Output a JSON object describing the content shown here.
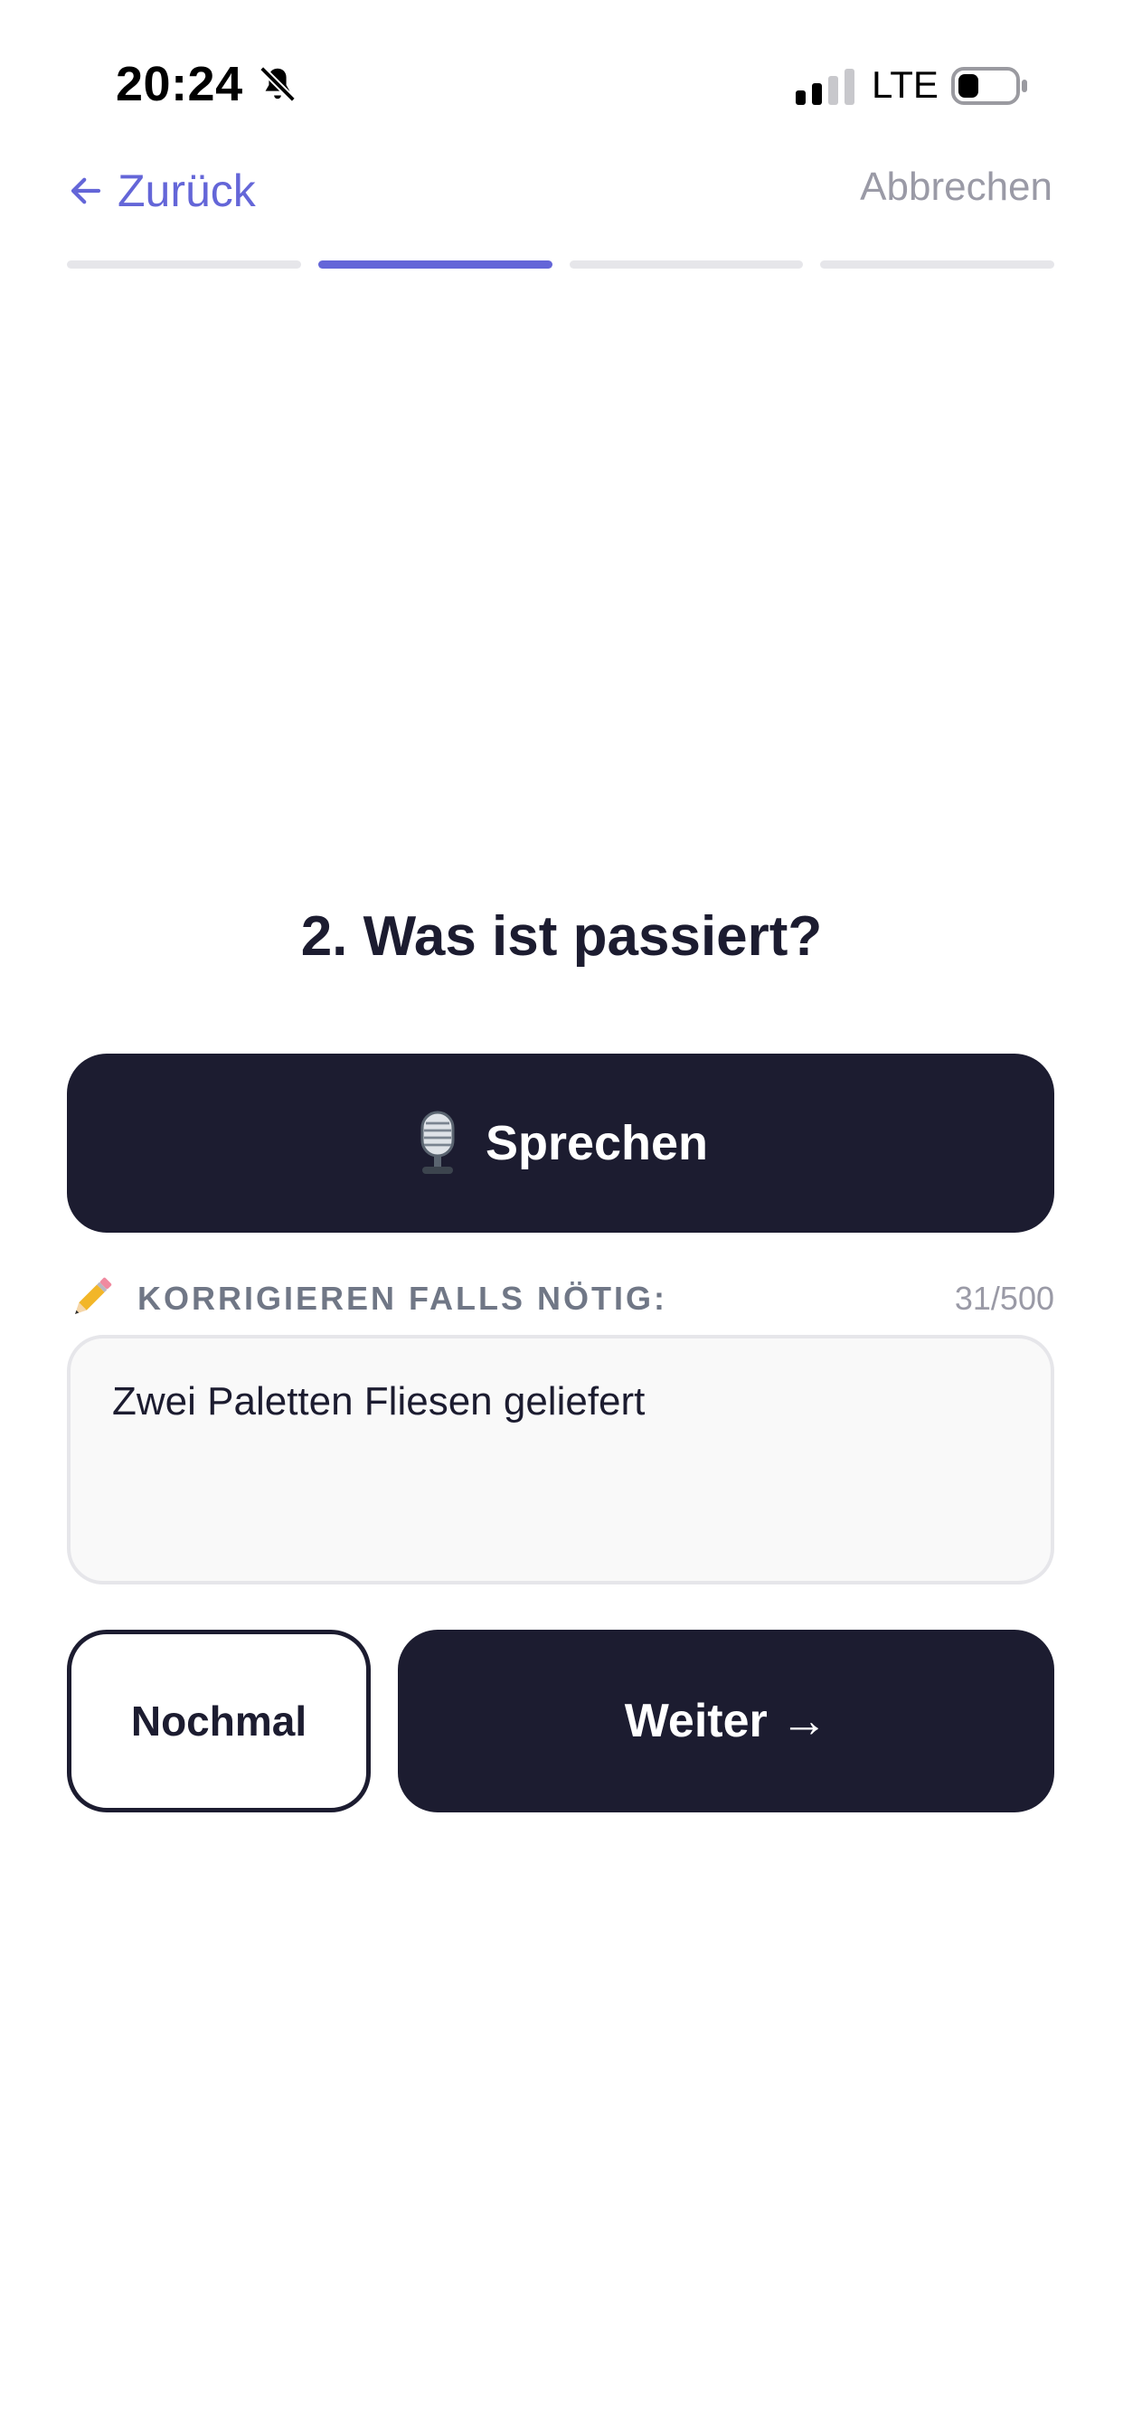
{
  "status_bar": {
    "time": "20:24",
    "network": "LTE",
    "icons": [
      "bell-off-icon",
      "signal-icon",
      "battery-icon"
    ]
  },
  "nav": {
    "back_label": "Zurück",
    "cancel_label": "Abbrechen",
    "back_icon": "arrow-left-icon"
  },
  "progress": {
    "total_steps": 4,
    "current_step": 2
  },
  "question": {
    "title": "2. Was ist passiert?"
  },
  "speak_button": {
    "label": "Sprechen",
    "icon": "microphone-icon"
  },
  "correction": {
    "icon": "pencil-icon",
    "label": "KORRIGIEREN FALLS NÖTIG:",
    "char_count": "31/500",
    "value": "Zwei Paletten Fliesen geliefert"
  },
  "actions": {
    "again_label": "Nochmal",
    "next_label": "Weiter →"
  },
  "colors": {
    "accent": "#6466d8",
    "dark": "#1c1c30",
    "muted": "#9a9aa6",
    "label_gray": "#707786",
    "track": "#e6e6ea"
  }
}
